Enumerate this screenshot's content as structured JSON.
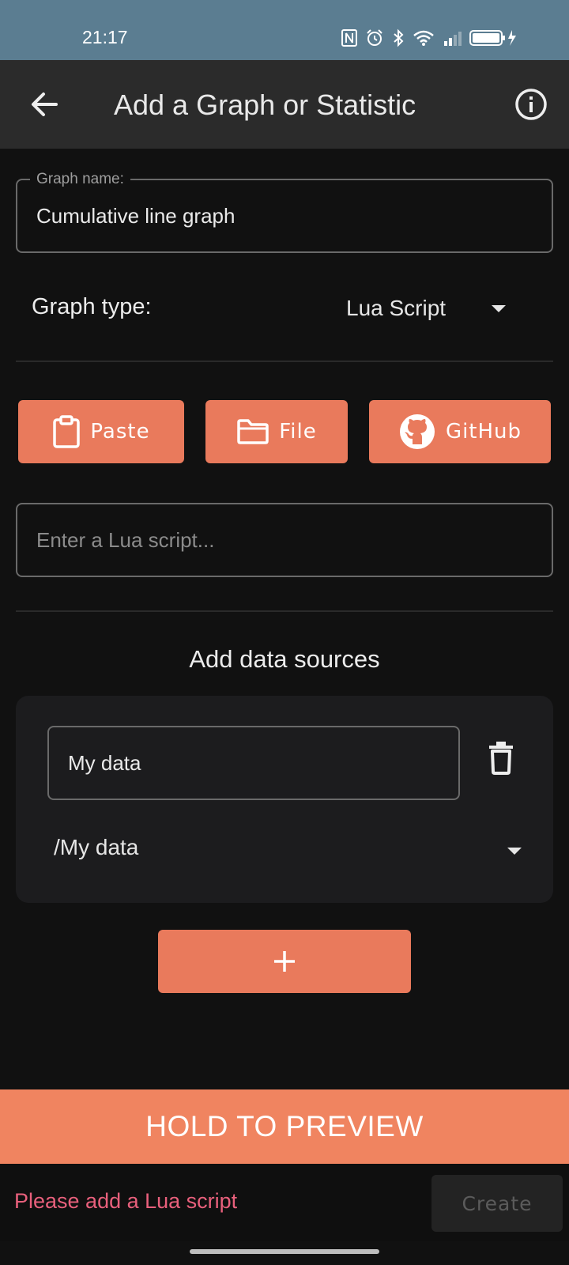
{
  "status_bar": {
    "time": "21:17",
    "icons": [
      "nfc-icon",
      "alarm-icon",
      "bluetooth-icon",
      "wifi-icon",
      "signal-icon",
      "battery-charging-icon"
    ]
  },
  "app_bar": {
    "title": "Add a Graph or Statistic",
    "back_icon": "arrow-back-icon",
    "info_icon": "info-icon"
  },
  "form": {
    "graph_name": {
      "label": "Graph name:",
      "value": "Cumulative line graph"
    },
    "graph_type": {
      "label": "Graph type:",
      "value": "Lua Script"
    },
    "script_buttons": [
      {
        "label": "Paste",
        "icon": "clipboard-icon"
      },
      {
        "label": "File",
        "icon": "folder-icon"
      },
      {
        "label": "GitHub",
        "icon": "github-icon"
      }
    ],
    "script_input": {
      "placeholder": "Enter a Lua script..."
    }
  },
  "data_sources": {
    "title": "Add data sources",
    "items": [
      {
        "name": "My data",
        "path": "/My data"
      }
    ],
    "add_label": "+"
  },
  "footer": {
    "preview_label": "HOLD TO PREVIEW",
    "error": "Please add a Lua script",
    "create_label": "Create"
  },
  "colors": {
    "accent": "#e97a5c",
    "preview": "#f08460",
    "error": "#e8607c",
    "status_bar": "#5b7d91",
    "app_bar": "#2b2b2b",
    "background": "#111111"
  }
}
